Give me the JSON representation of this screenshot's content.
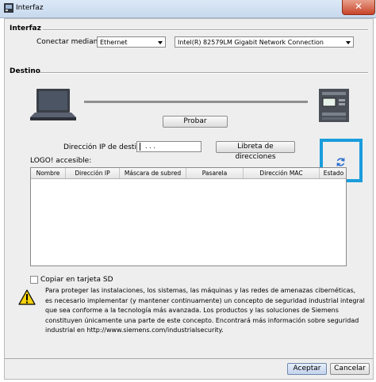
{
  "window": {
    "title": "Interfaz",
    "close_label": "✕"
  },
  "interfaz": {
    "section_title": "Interfaz",
    "connect_label": "Conectar mediante:",
    "connect_value": "Ethernet",
    "adapter_value": "Intel(R) 82579LM Gigabit Network Connection"
  },
  "destino": {
    "section_title": "Destino",
    "test_button": "Probar",
    "ip_label": "Dirección IP de destino:",
    "ip_value": ". . .",
    "address_book_button": "Libreta de direcciones",
    "accessible_label": "LOGO! accesible:",
    "refresh_icon": "refresh-icon",
    "columns": [
      "Nombre",
      "Dirección IP",
      "Máscara de subred",
      "Pasarela",
      "Dirección MAC",
      "Estado"
    ]
  },
  "sd": {
    "label": "Copiar en tarjeta SD",
    "checked": false
  },
  "warning": {
    "icon": "warning-icon",
    "lines": [
      "Para proteger las instalaciones, los sistemas, las máquinas y las redes de amenazas cibernéticas,",
      "es necesario implementar (y mantener continuamente) un concepto de seguridad industrial integral",
      "que sea conforme a la tecnología más avanzada. Los productos y las soluciones de Siemens",
      "constituyen únicamente una parte de este concepto. Encontrará más información sobre seguridad",
      "industrial en http://www.siemens.com/industrialsecurity."
    ]
  },
  "footer": {
    "accept_button": "Aceptar",
    "cancel_button": "Cancelar"
  },
  "colors": {
    "highlight": "#1a9ddc",
    "close": "#c8442a"
  }
}
